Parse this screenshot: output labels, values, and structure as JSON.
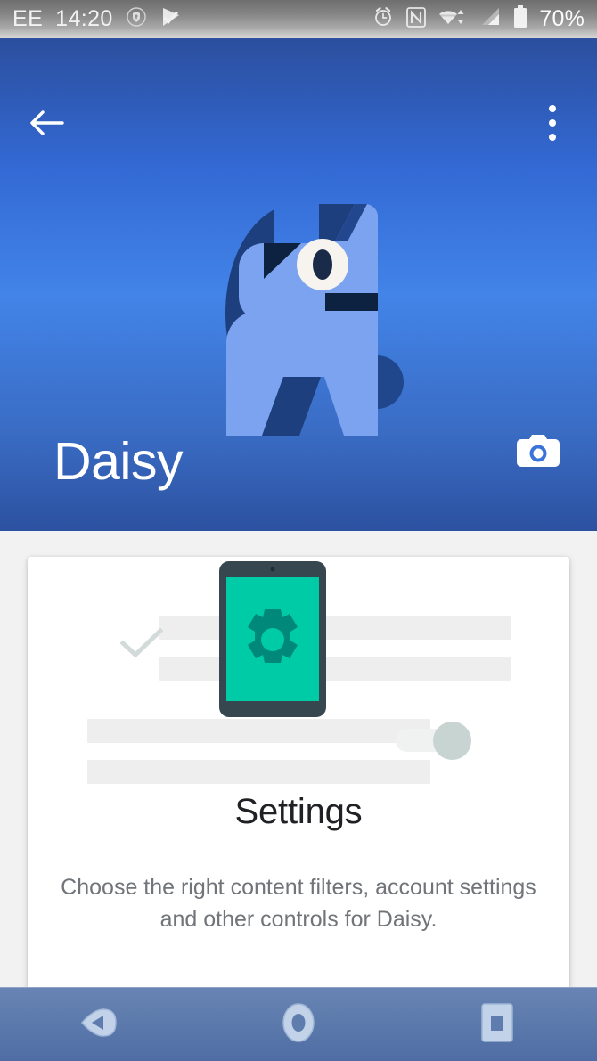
{
  "status_bar": {
    "carrier": "EE",
    "time": "14:20",
    "battery_percent": "70%",
    "left_icons": [
      "vpn-shield-icon",
      "play-store-check-icon"
    ],
    "right_icons": [
      "alarm-clock-icon",
      "nfc-icon",
      "wifi-icon",
      "cellular-signal-icon",
      "battery-icon"
    ]
  },
  "hero": {
    "title": "Daisy",
    "back_icon": "back-arrow-icon",
    "overflow_icon": "overflow-menu-icon",
    "camera_icon": "camera-icon",
    "avatar_icon": "dog-avatar-illustration",
    "gradient_top": "#2b4f9e",
    "gradient_mid": "#4284e8",
    "gradient_bottom": "#2c51a0"
  },
  "card": {
    "title": "Settings",
    "body": "Choose the right content filters, account settings and other controls for Daisy.",
    "illustration": {
      "name": "settings-tablet-illustration",
      "tablet_bezel_color": "#37474f",
      "tablet_screen_color": "#00cba7",
      "gear_color": "#00897b",
      "placeholder_bar_color": "#eeeeef",
      "check_color": "#d2dbda",
      "toggle_thumb_color": "#c8d4d2",
      "toggle_track_color": "#f0f2f2"
    }
  },
  "nav_bar": {
    "buttons": [
      {
        "name": "nav-back-button",
        "icon": "triangle-back-icon"
      },
      {
        "name": "nav-home-button",
        "icon": "circle-home-icon"
      },
      {
        "name": "nav-recents-button",
        "icon": "square-recents-icon"
      }
    ]
  }
}
